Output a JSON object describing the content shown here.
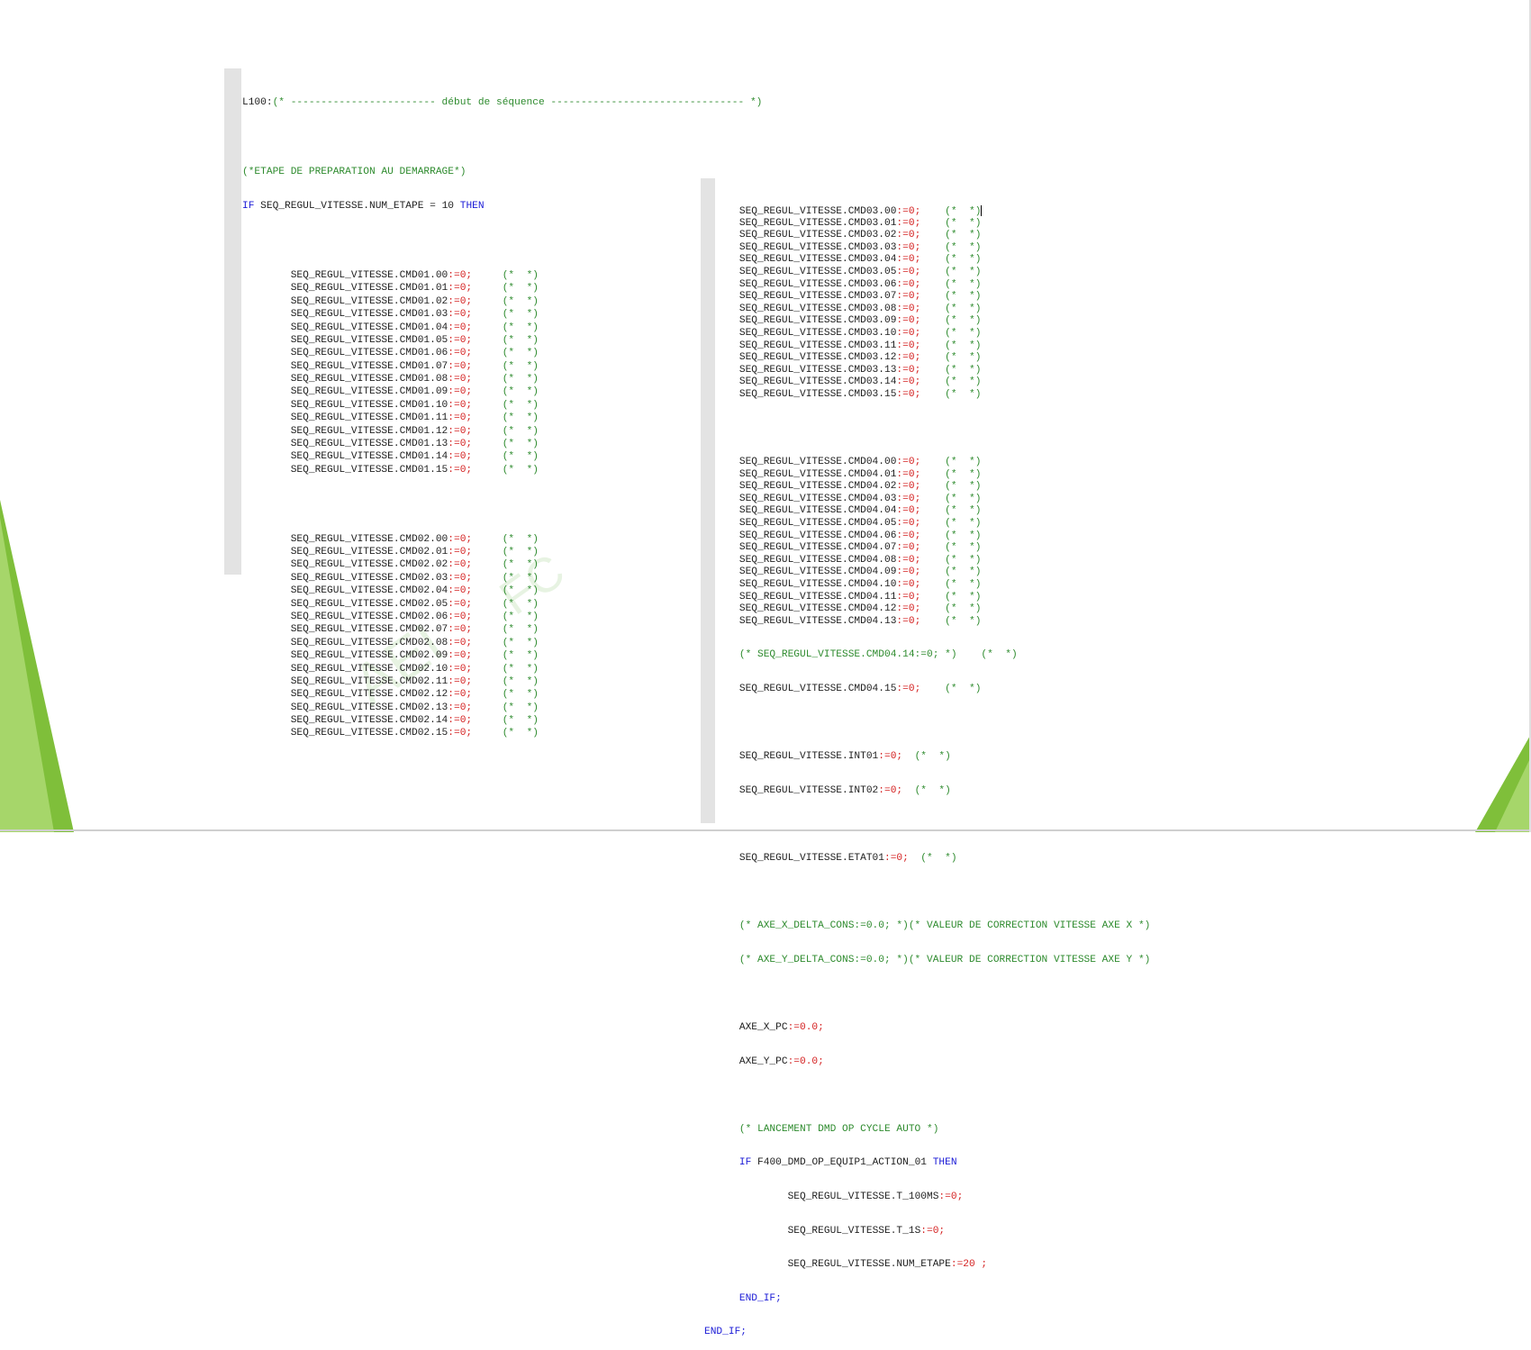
{
  "left": {
    "header_label": "L100:",
    "header_comment": "(* ------------------------ début de séquence -------------------------------- *)",
    "step_comment": "(*ETAPE DE PREPARATION AU DEMARRAGE*)",
    "if_kw": "IF",
    "if_cond": "SEQ_REGUL_VITESSE.NUM_ETAPE",
    "if_op": "=",
    "if_val": "10",
    "then_kw": "THEN",
    "group1": [
      "SEQ_REGUL_VITESSE.CMD01.00",
      "SEQ_REGUL_VITESSE.CMD01.01",
      "SEQ_REGUL_VITESSE.CMD01.02",
      "SEQ_REGUL_VITESSE.CMD01.03",
      "SEQ_REGUL_VITESSE.CMD01.04",
      "SEQ_REGUL_VITESSE.CMD01.05",
      "SEQ_REGUL_VITESSE.CMD01.06",
      "SEQ_REGUL_VITESSE.CMD01.07",
      "SEQ_REGUL_VITESSE.CMD01.08",
      "SEQ_REGUL_VITESSE.CMD01.09",
      "SEQ_REGUL_VITESSE.CMD01.10",
      "SEQ_REGUL_VITESSE.CMD01.11",
      "SEQ_REGUL_VITESSE.CMD01.12",
      "SEQ_REGUL_VITESSE.CMD01.13",
      "SEQ_REGUL_VITESSE.CMD01.14",
      "SEQ_REGUL_VITESSE.CMD01.15"
    ],
    "group2": [
      "SEQ_REGUL_VITESSE.CMD02.00",
      "SEQ_REGUL_VITESSE.CMD02.01",
      "SEQ_REGUL_VITESSE.CMD02.02",
      "SEQ_REGUL_VITESSE.CMD02.03",
      "SEQ_REGUL_VITESSE.CMD02.04",
      "SEQ_REGUL_VITESSE.CMD02.05",
      "SEQ_REGUL_VITESSE.CMD02.06",
      "SEQ_REGUL_VITESSE.CMD02.07",
      "SEQ_REGUL_VITESSE.CMD02.08",
      "SEQ_REGUL_VITESSE.CMD02.09",
      "SEQ_REGUL_VITESSE.CMD02.10",
      "SEQ_REGUL_VITESSE.CMD02.11",
      "SEQ_REGUL_VITESSE.CMD02.12",
      "SEQ_REGUL_VITESSE.CMD02.13",
      "SEQ_REGUL_VITESSE.CMD02.14",
      "SEQ_REGUL_VITESSE.CMD02.15"
    ]
  },
  "assign": ":=0;",
  "empty_comment": "(*  *)",
  "right": {
    "group3": [
      "SEQ_REGUL_VITESSE.CMD03.00",
      "SEQ_REGUL_VITESSE.CMD03.01",
      "SEQ_REGUL_VITESSE.CMD03.02",
      "SEQ_REGUL_VITESSE.CMD03.03",
      "SEQ_REGUL_VITESSE.CMD03.04",
      "SEQ_REGUL_VITESSE.CMD03.05",
      "SEQ_REGUL_VITESSE.CMD03.06",
      "SEQ_REGUL_VITESSE.CMD03.07",
      "SEQ_REGUL_VITESSE.CMD03.08",
      "SEQ_REGUL_VITESSE.CMD03.09",
      "SEQ_REGUL_VITESSE.CMD03.10",
      "SEQ_REGUL_VITESSE.CMD03.11",
      "SEQ_REGUL_VITESSE.CMD03.12",
      "SEQ_REGUL_VITESSE.CMD03.13",
      "SEQ_REGUL_VITESSE.CMD03.14",
      "SEQ_REGUL_VITESSE.CMD03.15"
    ],
    "group4": [
      "SEQ_REGUL_VITESSE.CMD04.00",
      "SEQ_REGUL_VITESSE.CMD04.01",
      "SEQ_REGUL_VITESSE.CMD04.02",
      "SEQ_REGUL_VITESSE.CMD04.03",
      "SEQ_REGUL_VITESSE.CMD04.04",
      "SEQ_REGUL_VITESSE.CMD04.05",
      "SEQ_REGUL_VITESSE.CMD04.06",
      "SEQ_REGUL_VITESSE.CMD04.07",
      "SEQ_REGUL_VITESSE.CMD04.08",
      "SEQ_REGUL_VITESSE.CMD04.09",
      "SEQ_REGUL_VITESSE.CMD04.10",
      "SEQ_REGUL_VITESSE.CMD04.11",
      "SEQ_REGUL_VITESSE.CMD04.12",
      "SEQ_REGUL_VITESSE.CMD04.13"
    ],
    "commented_line": "(* SEQ_REGUL_VITESSE.CMD04.14:=0; *)",
    "cmd0415": "SEQ_REGUL_VITESSE.CMD04.15",
    "int01": "SEQ_REGUL_VITESSE.INT01",
    "int02": "SEQ_REGUL_VITESSE.INT02",
    "etat01": "SEQ_REGUL_VITESSE.ETAT01",
    "axe_x_comment": "(* AXE_X_DELTA_CONS:=0.0; *)(* VALEUR DE CORRECTION VITESSE AXE X *)",
    "axe_y_comment": "(* AXE_Y_DELTA_CONS:=0.0; *)(* VALEUR DE CORRECTION VITESSE AXE Y *)",
    "axe_x_pc": "AXE_X_PC",
    "axe_y_pc": "AXE_Y_PC",
    "assign_real": ":=0.0;",
    "launch_comment": "(* LANCEMENT DMD OP CYCLE AUTO *)",
    "if_kw": "IF",
    "if_cond": "F400_DMD_OP_EQUIP1_ACTION_01",
    "then_kw": "THEN",
    "t100ms": "SEQ_REGUL_VITESSE.T_100MS",
    "t1s": "SEQ_REGUL_VITESSE.T_1S",
    "num_etape": "SEQ_REGUL_VITESSE.NUM_ETAPE",
    "assign20": ":=20 ;",
    "end_if_inner": "END_IF;",
    "end_if_outer": "END_IF;"
  },
  "watermark": "AEI",
  "watermark2": "FC",
  "colors": {
    "keyword": "#1a1ad6",
    "comment": "#2e8b2e",
    "operator": "#d42020",
    "gutter": "#e3e3e3",
    "accent_green": "#8cc63f"
  }
}
